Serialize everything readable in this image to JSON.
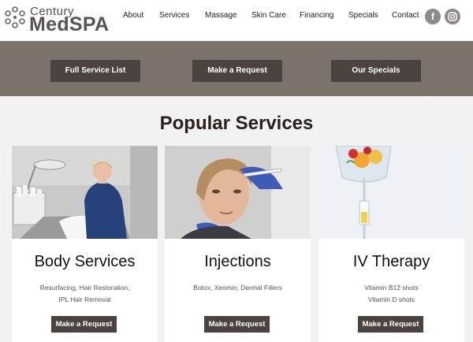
{
  "brand": {
    "line1": "Century",
    "line2": "MedSPA"
  },
  "nav": [
    "About",
    "Services",
    "Massage",
    "Skin Care",
    "Financing",
    "Specials",
    "Contact"
  ],
  "social": [
    {
      "icon": "facebook-icon",
      "glyph": "f"
    },
    {
      "icon": "instagram-icon",
      "glyph": "◎"
    }
  ],
  "banner": {
    "buttons": [
      "Full Service List",
      "Make a Request",
      "Our Specials"
    ]
  },
  "section": {
    "title": "Popular Services"
  },
  "cards": [
    {
      "title": "Body Services",
      "desc_line1": "Resurfacing, Hair Restoration,",
      "desc_line2": "IPL Hair Removal",
      "button": "Make a Request"
    },
    {
      "title": "Injections",
      "desc_line1": "Botox, Xeomin, Dermal Fillers",
      "desc_line2": "",
      "button": "Make a Request"
    },
    {
      "title": "IV Therapy",
      "desc_line1": "Vitamin B12 shots",
      "desc_line2": "Vitamin D shots",
      "button": "Make a Request"
    }
  ],
  "colors": {
    "banner": "#7b726c",
    "button": "#4a4340",
    "brand": "#5a5254"
  }
}
